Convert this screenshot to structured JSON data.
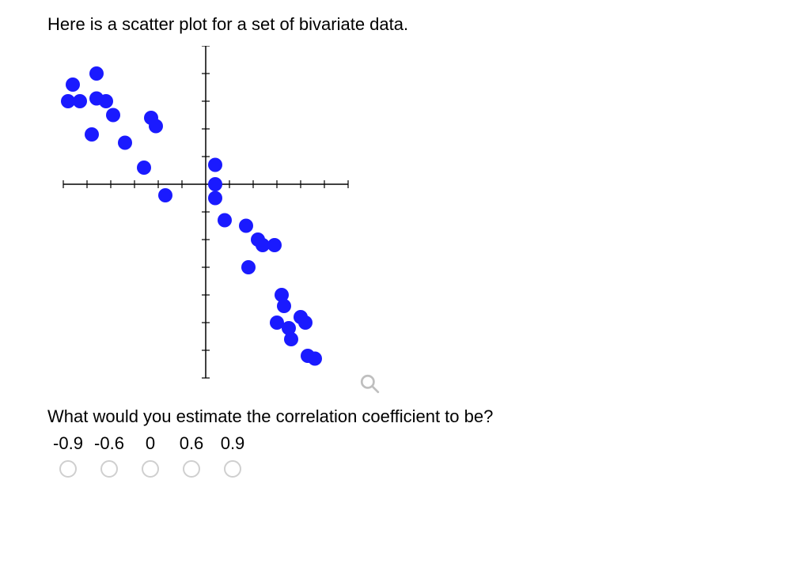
{
  "intro_text": "Here is a scatter plot for a set of bivariate data.",
  "question_text": "What would you estimate the correlation coefficient to be?",
  "options": [
    "-0.9",
    "-0.6",
    "0",
    "0.6",
    "0.9"
  ],
  "chart_data": {
    "type": "scatter",
    "xlabel": "",
    "ylabel": "",
    "xlim": [
      -6,
      6
    ],
    "ylim": [
      -7,
      5
    ],
    "xticks": [
      -6,
      -5,
      -4,
      -3,
      -2,
      -1,
      0,
      1,
      2,
      3,
      4,
      5,
      6
    ],
    "yticks": [
      -7,
      -6,
      -5,
      -4,
      -3,
      -2,
      -1,
      0,
      1,
      2,
      3,
      4,
      5
    ],
    "points": [
      {
        "x": -5.6,
        "y": 3.6
      },
      {
        "x": -5.8,
        "y": 3.0
      },
      {
        "x": -5.3,
        "y": 3.0
      },
      {
        "x": -4.6,
        "y": 4.0
      },
      {
        "x": -4.6,
        "y": 3.1
      },
      {
        "x": -4.2,
        "y": 3.0
      },
      {
        "x": -3.9,
        "y": 2.5
      },
      {
        "x": -4.8,
        "y": 1.8
      },
      {
        "x": -3.4,
        "y": 1.5
      },
      {
        "x": -2.3,
        "y": 2.4
      },
      {
        "x": -2.1,
        "y": 2.1
      },
      {
        "x": -2.6,
        "y": 0.6
      },
      {
        "x": -1.7,
        "y": -0.4
      },
      {
        "x": 0.4,
        "y": 0.7
      },
      {
        "x": 0.4,
        "y": 0.0
      },
      {
        "x": 0.4,
        "y": -0.5
      },
      {
        "x": 0.8,
        "y": -1.3
      },
      {
        "x": 1.7,
        "y": -1.5
      },
      {
        "x": 2.2,
        "y": -2.0
      },
      {
        "x": 2.4,
        "y": -2.2
      },
      {
        "x": 2.9,
        "y": -2.2
      },
      {
        "x": 1.8,
        "y": -3.0
      },
      {
        "x": 3.2,
        "y": -4.0
      },
      {
        "x": 3.3,
        "y": -4.4
      },
      {
        "x": 3.0,
        "y": -5.0
      },
      {
        "x": 3.5,
        "y": -5.2
      },
      {
        "x": 4.0,
        "y": -4.8
      },
      {
        "x": 4.2,
        "y": -5.0
      },
      {
        "x": 3.6,
        "y": -5.6
      },
      {
        "x": 4.3,
        "y": -6.2
      },
      {
        "x": 4.6,
        "y": -6.3
      }
    ]
  }
}
